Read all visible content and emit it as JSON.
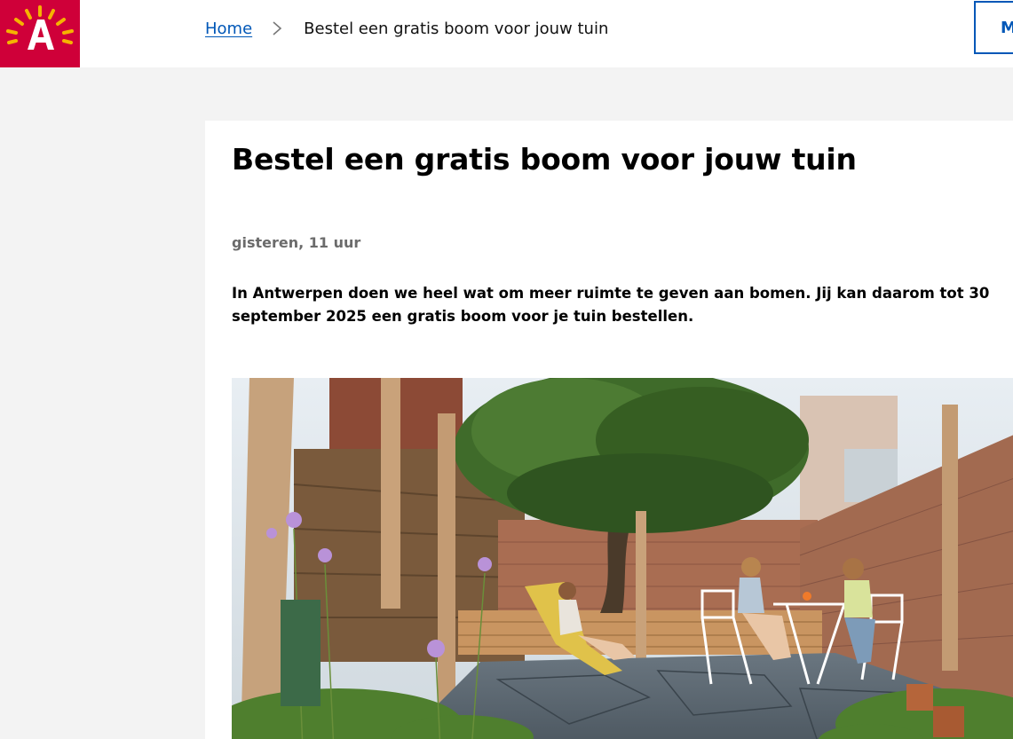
{
  "header": {
    "logo_alt": "A",
    "breadcrumb": {
      "home": "Home",
      "current": "Bestel een gratis boom voor jouw tuin"
    },
    "menu_label": "Menu"
  },
  "article": {
    "title": "Bestel een gratis boom voor jouw tuin",
    "date": "gisteren, 11 uur",
    "intro": "In Antwerpen doen we heel wat om meer ruimte te geven aan bomen. Jij kan daarom tot 30 september 2025 een gratis boom voor je tuin bestellen."
  },
  "colors": {
    "brand_red": "#cf0039",
    "link_blue": "#0057b7",
    "page_bg": "#f3f3f3"
  }
}
